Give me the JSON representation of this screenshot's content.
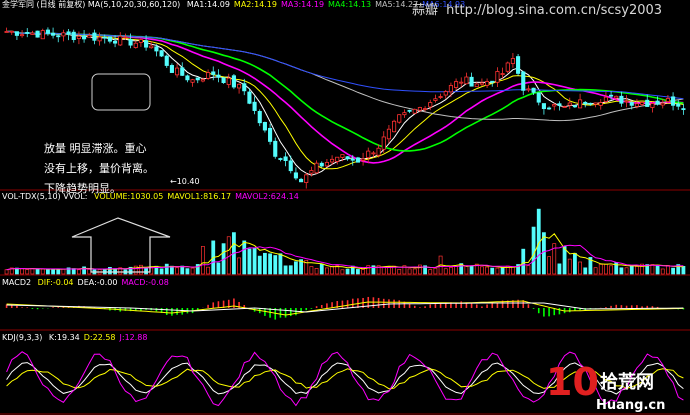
{
  "main_panel": {
    "stock_name": "金学军同",
    "period_label": "(日线 前复权)",
    "ma_params": "MA(5,10,20,30,60,120)",
    "ma_readouts": [
      {
        "label": "MA1:14.09",
        "color": "#ffffff"
      },
      {
        "label": "MA2:14.19",
        "color": "#ffff00"
      },
      {
        "label": "MA3:14.19",
        "color": "#ff00ff"
      },
      {
        "label": "MA4:14.13",
        "color": "#00ff00"
      },
      {
        "label": "MA5:14.27",
        "color": "#c0c0c0"
      },
      {
        "label": "MA6:14.93",
        "color": "#3050ff"
      }
    ],
    "low_price_marker": "10.40",
    "annotation_lines": [
      "放量 明显滞涨。重心",
      "没有上移，量价背离。",
      "下降趋势明显。"
    ]
  },
  "watermark": {
    "author": "蒜瓣",
    "url": "http://blog.sina.com.cn/scsy2003",
    "logo_main": "拾荒网",
    "logo_digits": "10",
    "logo_domain": "Huang.cn"
  },
  "volume_panel": {
    "indicator": "VOL-TDX(5,10)",
    "title": "VVOL:",
    "readouts": [
      {
        "label": "VOLUME:1030.05",
        "color": "#ffff00"
      },
      {
        "label": "MAVOL1:816.17",
        "color": "#ffff00"
      },
      {
        "label": "MAVOL2:624.14",
        "color": "#ff00ff"
      }
    ]
  },
  "macd_panel": {
    "indicator": "MACD2",
    "readouts": [
      {
        "label": "DIF:-0.04",
        "color": "#ffff00"
      },
      {
        "label": "DEA:-0.00",
        "color": "#ffffff"
      },
      {
        "label": "MACD:-0.08",
        "color": "#ff00ff"
      }
    ]
  },
  "kdj_panel": {
    "indicator": "KDJ(9,3,3)",
    "readouts": [
      {
        "label": "K:19.34",
        "color": "#ffffff"
      },
      {
        "label": "D:22.58",
        "color": "#ffff00"
      },
      {
        "label": "J:12.88",
        "color": "#ff00ff"
      }
    ]
  },
  "colors": {
    "up": "#ff3232",
    "down": "#54fcfc",
    "background": "#000000",
    "panel_border": "#8b0000"
  },
  "chart_data": [
    {
      "type": "candlestick",
      "title": "",
      "x_count": 132,
      "ylim": [
        10.0,
        20.0
      ],
      "price_points": [
        [
          0,
          19.0
        ],
        [
          10,
          18.8
        ],
        [
          20,
          18.6
        ],
        [
          28,
          18.2
        ],
        [
          32,
          16.8
        ],
        [
          36,
          16.2
        ],
        [
          40,
          16.6
        ],
        [
          46,
          15.6
        ],
        [
          52,
          12.0
        ],
        [
          54,
          11.6
        ],
        [
          57,
          10.4
        ],
        [
          60,
          11.2
        ],
        [
          64,
          11.8
        ],
        [
          68,
          11.6
        ],
        [
          72,
          12.4
        ],
        [
          76,
          14.0
        ],
        [
          80,
          14.6
        ],
        [
          84,
          15.4
        ],
        [
          88,
          16.2
        ],
        [
          92,
          16.0
        ],
        [
          96,
          16.6
        ],
        [
          98,
          17.4
        ],
        [
          100,
          15.8
        ],
        [
          104,
          14.8
        ],
        [
          108,
          14.6
        ],
        [
          112,
          15.0
        ],
        [
          116,
          15.2
        ],
        [
          120,
          15.0
        ],
        [
          124,
          14.9
        ],
        [
          128,
          15.0
        ],
        [
          131,
          14.8
        ]
      ],
      "moving_averages": [
        {
          "name": "MA1",
          "period": 5,
          "color": "#ffffff"
        },
        {
          "name": "MA2",
          "period": 10,
          "color": "#ffff00"
        },
        {
          "name": "MA3",
          "period": 20,
          "color": "#ff00ff"
        },
        {
          "name": "MA4",
          "period": 30,
          "color": "#00ff00"
        },
        {
          "name": "MA5",
          "period": 60,
          "color": "#c0c0c0"
        },
        {
          "name": "MA6",
          "period": 120,
          "color": "#3050ff"
        }
      ]
    },
    {
      "type": "bar",
      "title": "",
      "baseline_points": [
        [
          0,
          450
        ],
        [
          25,
          450
        ],
        [
          42,
          700
        ],
        [
          48,
          1500
        ],
        [
          56,
          800
        ],
        [
          64,
          450
        ],
        [
          80,
          520
        ],
        [
          100,
          650
        ],
        [
          104,
          1200
        ],
        [
          110,
          700
        ],
        [
          131,
          500
        ]
      ],
      "spikes": [
        [
          38,
          2000
        ],
        [
          40,
          2400
        ],
        [
          42,
          2200
        ],
        [
          43,
          2700
        ],
        [
          44,
          3000
        ],
        [
          46,
          2400
        ],
        [
          48,
          1900
        ],
        [
          50,
          1500
        ],
        [
          84,
          1300
        ],
        [
          100,
          1800
        ],
        [
          102,
          3400
        ],
        [
          103,
          4700
        ],
        [
          104,
          3000
        ],
        [
          106,
          2200
        ],
        [
          108,
          2000
        ],
        [
          110,
          1500
        ],
        [
          113,
          1200
        ]
      ],
      "ylim": [
        0,
        5000
      ]
    },
    {
      "type": "bar",
      "title": "",
      "macd_points": [
        [
          0,
          0.15
        ],
        [
          6,
          -0.05
        ],
        [
          14,
          0.12
        ],
        [
          22,
          -0.18
        ],
        [
          28,
          -0.1
        ],
        [
          32,
          -0.4
        ],
        [
          36,
          -0.25
        ],
        [
          40,
          0.3
        ],
        [
          44,
          0.45
        ],
        [
          48,
          -0.2
        ],
        [
          52,
          -0.55
        ],
        [
          56,
          -0.35
        ],
        [
          60,
          0.1
        ],
        [
          64,
          0.35
        ],
        [
          70,
          0.55
        ],
        [
          76,
          0.4
        ],
        [
          80,
          0.05
        ],
        [
          84,
          0.25
        ],
        [
          88,
          0.3
        ],
        [
          92,
          0.1
        ],
        [
          96,
          0.35
        ],
        [
          100,
          0.4
        ],
        [
          104,
          -0.45
        ],
        [
          108,
          -0.25
        ],
        [
          112,
          -0.1
        ],
        [
          118,
          0.15
        ],
        [
          124,
          0.1
        ],
        [
          131,
          -0.08
        ]
      ],
      "dif_points": [
        [
          0,
          0.4
        ],
        [
          20,
          -0.1
        ],
        [
          32,
          -0.5
        ],
        [
          44,
          0.2
        ],
        [
          54,
          -0.7
        ],
        [
          70,
          0.6
        ],
        [
          88,
          0.5
        ],
        [
          100,
          0.7
        ],
        [
          108,
          -0.3
        ],
        [
          131,
          -0.04
        ]
      ],
      "dea_points": [
        [
          0,
          0.3
        ],
        [
          24,
          0.0
        ],
        [
          36,
          -0.3
        ],
        [
          48,
          0.0
        ],
        [
          58,
          -0.4
        ],
        [
          74,
          0.4
        ],
        [
          92,
          0.5
        ],
        [
          104,
          0.5
        ],
        [
          112,
          -0.1
        ],
        [
          131,
          0.0
        ]
      ],
      "ylim": [
        -1,
        1
      ]
    },
    {
      "type": "line",
      "title": "",
      "series": [
        {
          "name": "K",
          "color": "#ffffff",
          "period": 9.5,
          "amplitude": 30,
          "phase": 0.0
        },
        {
          "name": "D",
          "color": "#ffff00",
          "period": 9.5,
          "amplitude": 18,
          "phase": -0.8
        },
        {
          "name": "J",
          "color": "#ff00ff",
          "period": 9.5,
          "amplitude": 48,
          "phase": 0.4
        }
      ],
      "ylim": [
        -20,
        120
      ]
    }
  ]
}
